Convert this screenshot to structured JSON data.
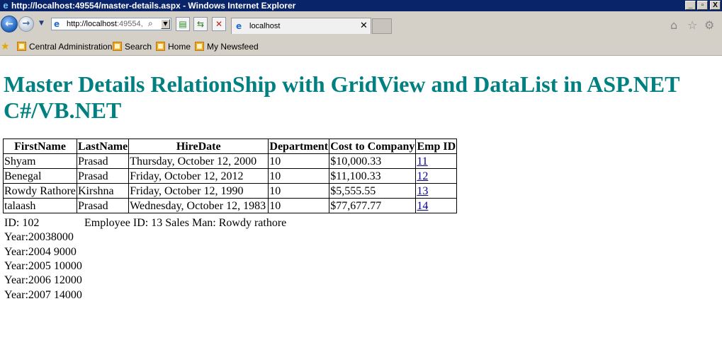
{
  "window": {
    "title": "http://localhost:49554/master-details.aspx - Windows Internet Explorer",
    "controls": {
      "minimize": "_",
      "maximize": "▫",
      "close": "X"
    }
  },
  "nav": {
    "address_host": "http://localhost",
    "address_rest": ":49554,",
    "tab_label": "localhost",
    "tab_close": "✕"
  },
  "favorites": {
    "items": [
      "Central Administration",
      "Search",
      "Home",
      "My Newsfeed"
    ]
  },
  "page": {
    "title": "Master Details RelationShip with GridView and DataList in ASP.NET C#/VB.NET"
  },
  "grid": {
    "headers": [
      "FirstName",
      "LastName",
      "HireDate",
      "Department",
      "Cost to Company",
      "Emp ID"
    ],
    "rows": [
      [
        "Shyam",
        "Prasad",
        "Thursday, October 12, 2000",
        "10",
        "$10,000.33",
        "11"
      ],
      [
        "Benegal",
        "Prasad",
        "Friday, October 12, 2012",
        "10",
        "$11,100.33",
        "12"
      ],
      [
        "Rowdy Rathore",
        "Kirshna",
        "Friday, October 12, 1990",
        "10",
        "$5,555.55",
        "13"
      ],
      [
        "talaash",
        "Prasad",
        "Wednesday, October 12, 1983",
        "10",
        "$77,677.77",
        "14"
      ]
    ]
  },
  "details": {
    "id_line": "ID: 102",
    "employee_line": "Employee ID: 13 Sales Man: Rowdy rathore",
    "years": [
      "Year:20038000",
      "Year:2004 9000",
      "Year:2005 10000",
      "Year:2006 12000",
      "Year:2007 14000"
    ]
  }
}
